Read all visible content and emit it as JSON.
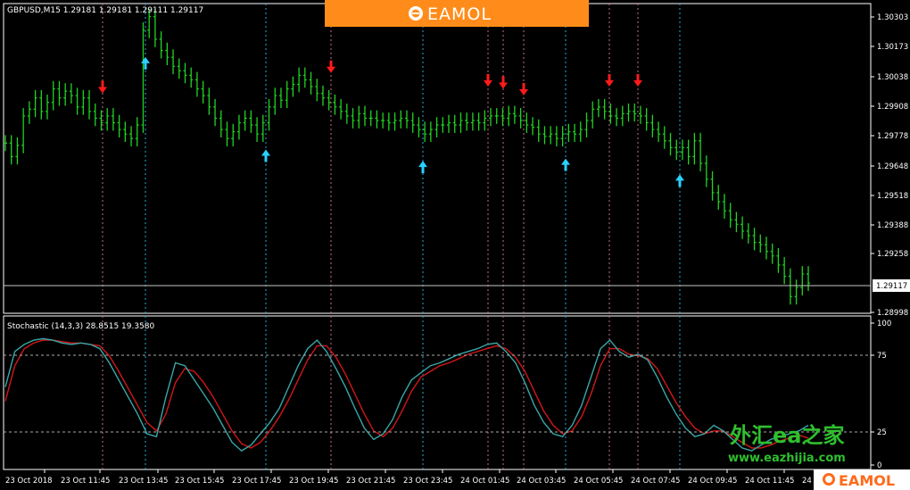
{
  "colors": {
    "background": "#000000",
    "candle": "#22d322",
    "sell_arrow": "#ff1a1a",
    "buy_arrow": "#2ad0ff",
    "stoch_main": "#3aa6a6",
    "stoch_signal": "#d01818",
    "brand_orange": "#ff8c1a"
  },
  "price_panel": {
    "label": "GBPUSD,M15  1.29181 1.29181 1.29111 1.29117",
    "current_price": "1.29117",
    "axis_ticks": [
      "1.30303",
      "1.30173",
      "1.30038",
      "1.29908",
      "1.29778",
      "1.29648",
      "1.29518",
      "1.29388",
      "1.29258",
      "1.29117",
      "1.28998"
    ]
  },
  "indicator_panel": {
    "label": "Stochastic (14,3,3) 28.8515 19.3580",
    "axis_ticks": [
      "100",
      "75",
      "25",
      "0"
    ]
  },
  "time_axis": [
    "23 Oct 2018",
    "23 Oct 11:45",
    "23 Oct 13:45",
    "23 Oct 15:45",
    "23 Oct 17:45",
    "23 Oct 19:45",
    "23 Oct 21:45",
    "23 Oct 23:45",
    "24 Oct 01:45",
    "24 Oct 03:45",
    "24 Oct 05:45",
    "24 Oct 07:45",
    "24 Oct 09:45",
    "24 Oct 11:45",
    "24"
  ],
  "brand": {
    "name": "EAMOL"
  },
  "watermark": {
    "line1": "外汇ea之家",
    "line2": "www.eazhijia.com"
  },
  "chart_data": {
    "type": "candlestick",
    "symbol": "GBPUSD",
    "timeframe": "M15",
    "ohlc_last": {
      "open": 1.29181,
      "high": 1.29181,
      "low": 1.29111,
      "close": 1.29117
    },
    "ylim": [
      1.2899,
      1.3035
    ],
    "closes": [
      1.2974,
      1.2968,
      1.2973,
      1.2986,
      1.2989,
      1.2994,
      1.2988,
      1.2992,
      1.2998,
      1.2994,
      1.2997,
      1.2995,
      1.299,
      1.2994,
      1.2988,
      1.2985,
      1.2983,
      1.2986,
      1.2983,
      1.298,
      1.2978,
      1.2976,
      1.2982,
      1.3024,
      1.303,
      1.302,
      1.3015,
      1.3012,
      1.3008,
      1.3006,
      1.3004,
      1.3002,
      1.2998,
      1.2995,
      1.299,
      1.2985,
      1.298,
      1.2976,
      1.2979,
      1.2983,
      1.2985,
      1.2982,
      1.2978,
      1.2983,
      1.299,
      1.2995,
      1.2993,
      1.2998,
      1.3,
      1.3004,
      1.3002,
      1.2999,
      1.2996,
      1.2994,
      1.2992,
      1.299,
      1.2988,
      1.2986,
      1.2984,
      1.2987,
      1.2985,
      1.2985,
      1.2984,
      1.2984,
      1.2983,
      1.2984,
      1.2985,
      1.2984,
      1.2982,
      1.298,
      1.2978,
      1.298,
      1.2982,
      1.2982,
      1.2983,
      1.2982,
      1.2984,
      1.2983,
      1.2984,
      1.2983,
      1.2985,
      1.2986,
      1.2986,
      1.2985,
      1.2987,
      1.2986,
      1.2984,
      1.2982,
      1.2981,
      1.2978,
      1.2977,
      1.2978,
      1.2976,
      1.2978,
      1.2979,
      1.2978,
      1.298,
      1.2984,
      1.2989,
      1.299,
      1.2988,
      1.2986,
      1.2985,
      1.2987,
      1.2988,
      1.2987,
      1.2986,
      1.2983,
      1.298,
      1.2978,
      1.2975,
      1.2972,
      1.297,
      1.2972,
      1.2968,
      1.2975,
      1.2965,
      1.2958,
      1.2952,
      1.2948,
      1.2944,
      1.294,
      1.2938,
      1.2935,
      1.2933,
      1.293,
      1.2929,
      1.2926,
      1.2924,
      1.292,
      1.2915,
      1.2906,
      1.291,
      1.2916,
      1.2912
    ],
    "sell_signals": [
      "23 Oct 11:45",
      "23 Oct 19:45",
      "24 Oct 01:15",
      "24 Oct 01:45",
      "24 Oct 02:45",
      "24 Oct 06:15",
      "24 Oct 07:15"
    ],
    "buy_signals": [
      "23 Oct 13:45",
      "23 Oct 17:45",
      "23 Oct 23:45",
      "24 Oct 03:45",
      "24 Oct 09:45"
    ],
    "stochastic": {
      "params": "14,3,3",
      "k_last": 28.8515,
      "d_last": 19.358,
      "levels": [
        75,
        25
      ],
      "ylim": [
        0,
        100
      ],
      "k": [
        55,
        80,
        85,
        88,
        89,
        88,
        86,
        85,
        86,
        85,
        82,
        72,
        60,
        48,
        36,
        22,
        20,
        48,
        72,
        70,
        60,
        50,
        40,
        28,
        16,
        10,
        14,
        22,
        30,
        40,
        55,
        70,
        82,
        88,
        80,
        68,
        55,
        40,
        26,
        18,
        22,
        32,
        48,
        60,
        65,
        70,
        72,
        75,
        78,
        80,
        82,
        85,
        86,
        80,
        72,
        58,
        42,
        30,
        22,
        20,
        28,
        42,
        62,
        82,
        88,
        80,
        76,
        78,
        74,
        62,
        48,
        36,
        26,
        20,
        22,
        28,
        24,
        18,
        12,
        10,
        14,
        18,
        20,
        22,
        24,
        28
      ],
      "d": [
        45,
        70,
        82,
        86,
        88,
        88,
        87,
        86,
        86,
        85,
        84,
        77,
        66,
        54,
        42,
        30,
        24,
        36,
        58,
        68,
        66,
        58,
        48,
        36,
        24,
        15,
        12,
        16,
        24,
        34,
        46,
        60,
        74,
        84,
        84,
        76,
        64,
        50,
        36,
        24,
        20,
        26,
        38,
        52,
        62,
        66,
        70,
        72,
        75,
        78,
        80,
        82,
        84,
        82,
        76,
        66,
        52,
        38,
        28,
        22,
        24,
        34,
        50,
        70,
        82,
        82,
        78,
        77,
        75,
        68,
        56,
        44,
        34,
        26,
        22,
        24,
        24,
        20,
        16,
        12,
        12,
        14,
        17,
        19,
        21,
        19
      ]
    }
  }
}
